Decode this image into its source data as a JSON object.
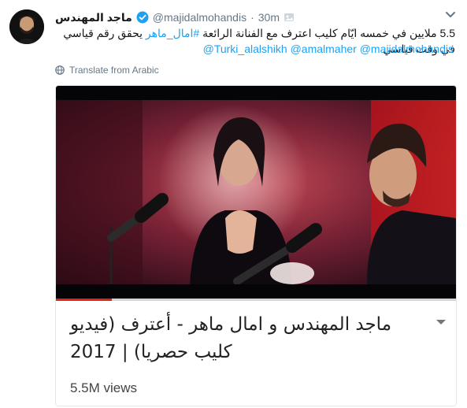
{
  "user": {
    "display_name": "ماجد المهندس",
    "handle": "@majidalmohandis",
    "separator": "·",
    "timestamp": "30m",
    "verified": true
  },
  "tweet": {
    "text_main": "5.5 ملايين في خمسه ايّام كليب اعترف  مع الفنانة الرائعة ",
    "text_link": "#امال_ماهر",
    "text_rest": " يحقق رقم قياسي في وقت قياسي",
    "mentions": [
      "@Turki_alalshikh",
      "@amalmaher",
      "@majidalmohandis"
    ]
  },
  "translate": {
    "label": "Translate from Arabic",
    "icon": "globe-icon"
  },
  "card": {
    "video_title": "ماجد المهندس و امال ماهر - أعترف (فيديو كليب حصريا) | 2017",
    "views": "5.5M views",
    "progress": 0.14,
    "progress_color": "#e62117"
  },
  "colors": {
    "link": "#1da1f2",
    "meta": "#657786",
    "text": "#14171a",
    "border": "#e1e8ed"
  },
  "icons": {
    "verified": "verified-badge-icon",
    "caret": "chevron-down-icon",
    "card_menu": "chevron-down-icon",
    "badge": "media-badge-icon"
  }
}
